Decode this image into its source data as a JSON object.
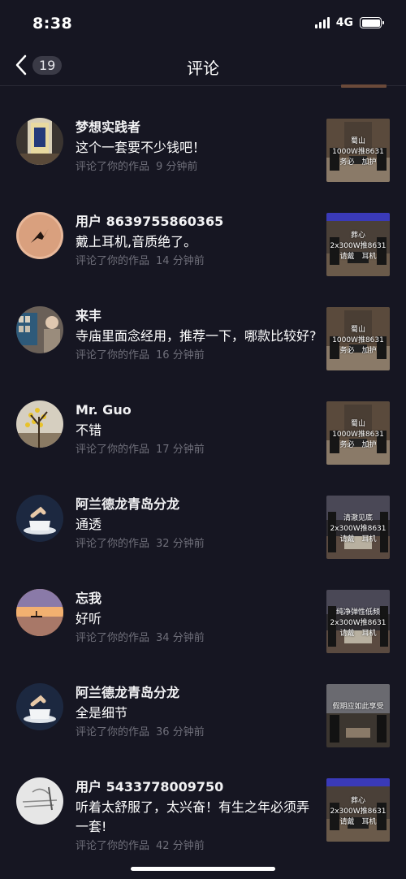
{
  "status": {
    "time": "8:38",
    "network": "4G"
  },
  "header": {
    "back_count": "19",
    "title": "评论"
  },
  "comments": [
    {
      "user": "梦想实践者",
      "text": "这个一套要不少钱吧！",
      "action": "评论了你的作品",
      "time": "9 分钟前",
      "thumb": [
        "蜀山",
        "1000W推8631",
        "务必　加护"
      ],
      "avatar": "bottle-photo",
      "thumb_style": "speaker-room"
    },
    {
      "user": "用户 8639755860365",
      "text": "戴上耳机,音质绝了。",
      "action": "评论了你的作品",
      "time": "14 分钟前",
      "thumb": [
        "葬心",
        "2x300W推8631",
        "请戴　耳机"
      ],
      "avatar": "bird-sunset",
      "thumb_style": "speaker-blue"
    },
    {
      "user": "来丰",
      "text": "寺庙里面念经用，推荐一下，哪款比较好?",
      "action": "评论了你的作品",
      "time": "16 分钟前",
      "thumb": [
        "蜀山",
        "1000W推8631",
        "务必　加护"
      ],
      "avatar": "shop-photo",
      "thumb_style": "speaker-room"
    },
    {
      "user": "Mr. Guo",
      "text": "不错",
      "action": "评论了你的作品",
      "time": "17 分钟前",
      "thumb": [
        "蜀山",
        "1000W推8631",
        "务必　加护"
      ],
      "avatar": "flower-tree",
      "thumb_style": "speaker-room"
    },
    {
      "user": "阿兰德龙青岛分龙",
      "text": "通透",
      "action": "评论了你的作品",
      "time": "32 分钟前",
      "thumb": [
        "清澈见底",
        "2x300W推8631",
        "请戴　耳机"
      ],
      "avatar": "coffee-cup",
      "thumb_style": "speaker-store"
    },
    {
      "user": "忘我",
      "text": "好听",
      "action": "评论了你的作品",
      "time": "34 分钟前",
      "thumb": [
        "纯净弹性低频",
        "2x300W推8631",
        "请戴　耳机"
      ],
      "avatar": "boat-sunset",
      "thumb_style": "speaker-store"
    },
    {
      "user": "阿兰德龙青岛分龙",
      "text": "全是细节",
      "action": "评论了你的作品",
      "time": "36 分钟前",
      "thumb": [
        "",
        "假期应如此享受",
        ""
      ],
      "avatar": "coffee-cup",
      "thumb_style": "speaker-dark"
    },
    {
      "user": "用户 5433778009750",
      "text": "听着太舒服了，太兴奋！有生之年必须弄一套!",
      "action": "评论了你的作品",
      "time": "42 分钟前",
      "thumb": [
        "葬心",
        "2x300W推8631",
        "请戴　耳机"
      ],
      "avatar": "sketch",
      "thumb_style": "speaker-blue"
    }
  ]
}
